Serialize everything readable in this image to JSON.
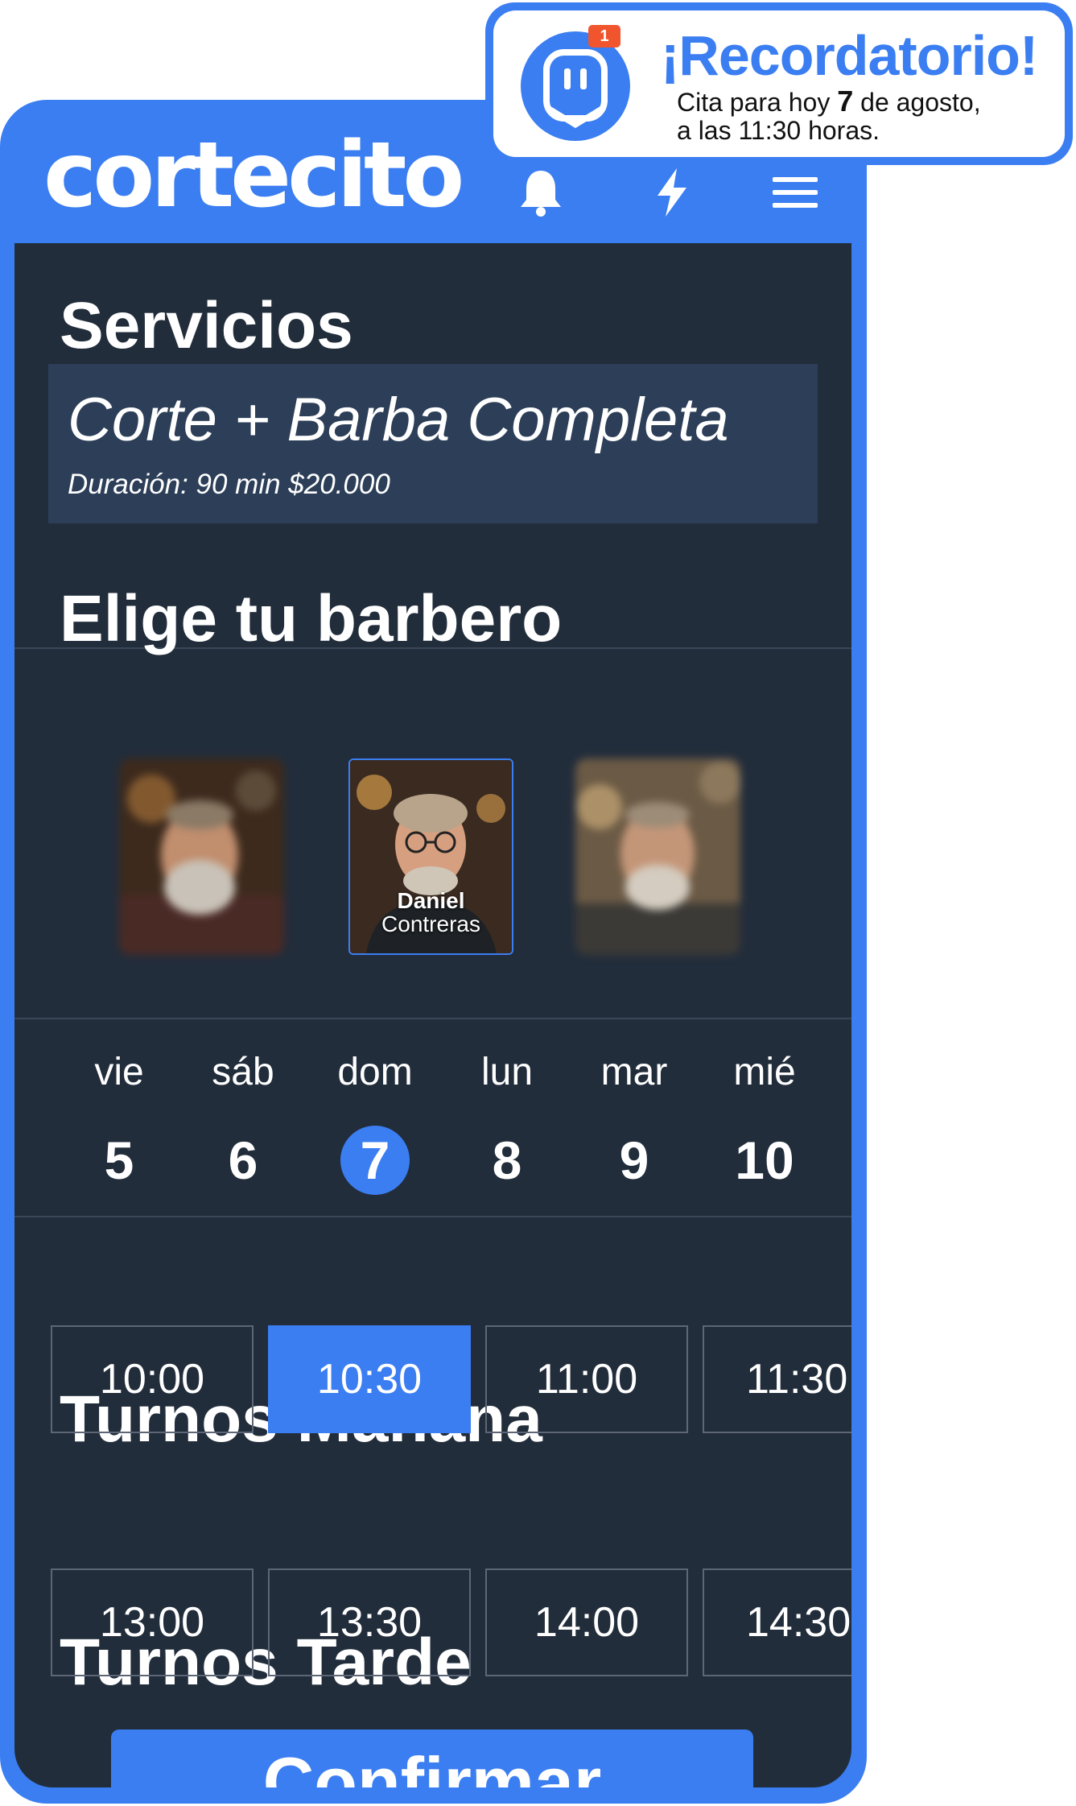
{
  "app": {
    "logo": "cortecito",
    "icons": [
      "bell-icon",
      "bolt-icon",
      "menu-icon"
    ]
  },
  "reminder": {
    "badge_count": "1",
    "title": "¡Recordatorio!",
    "message_pre": "Cita para hoy ",
    "message_day": "7",
    "message_post": " de agosto,",
    "message_line2": "a las 11:30 horas."
  },
  "services": {
    "title": "Servicios",
    "selected_name": "Corte + Barba Completa",
    "detail": "Duración: 90 min $20.000"
  },
  "barbers": {
    "title": "Elige tu barbero",
    "selected_first_name": "Daniel",
    "selected_last_name": "Contreras"
  },
  "days": [
    {
      "name": "vie",
      "num": "5",
      "selected": false
    },
    {
      "name": "sáb",
      "num": "6",
      "selected": false
    },
    {
      "name": "dom",
      "num": "7",
      "selected": true
    },
    {
      "name": "lun",
      "num": "8",
      "selected": false
    },
    {
      "name": "mar",
      "num": "9",
      "selected": false
    },
    {
      "name": "mié",
      "num": "10",
      "selected": false
    }
  ],
  "morning": {
    "title": "Turnos Mañana",
    "slots": [
      "10:00",
      "10:30",
      "11:00",
      "11:30"
    ],
    "selected": "10:30"
  },
  "afternoon": {
    "title": "Turnos Tarde",
    "slots": [
      "13:00",
      "13:30",
      "14:00",
      "14:30"
    ]
  },
  "confirm_label": "Confirmar",
  "colors": {
    "accent": "#3b7ef2",
    "panel": "#222d3b",
    "card": "#2c3e58",
    "badge": "#f0552d"
  }
}
